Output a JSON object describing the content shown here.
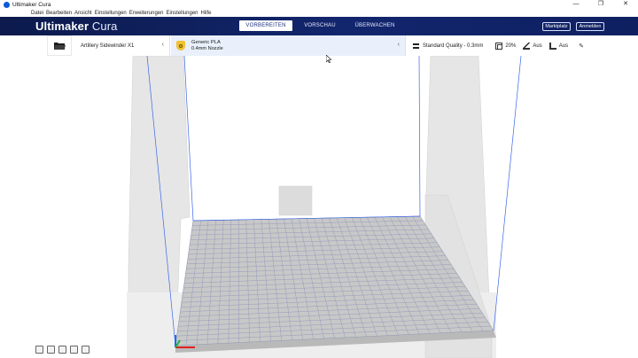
{
  "window": {
    "title": "Ultimaker Cura",
    "controls": [
      "—",
      "❐",
      "✕"
    ]
  },
  "menu": [
    "Datei",
    "Bearbeiten",
    "Ansicht",
    "Einstellungen",
    "Erweiterungen",
    "Einstellungen",
    "Hilfe"
  ],
  "header": {
    "logo_bold": "Ultimaker",
    "logo_light": "Cura",
    "stages": [
      {
        "label": "VORBEREITEN",
        "active": true
      },
      {
        "label": "VORSCHAU",
        "active": false
      },
      {
        "label": "ÜBERWACHEN",
        "active": false
      }
    ],
    "marketplace": "Marktplatz",
    "signin": "Anmelden"
  },
  "toolbar": {
    "printer": "Artillery Sidewinder X1",
    "material_name": "Generic PLA",
    "nozzle": "0.4mm Nozzle",
    "quality": "Standard Quality - 0.3mm",
    "infill": "20%",
    "support": "Aus",
    "adhesion": "Aus"
  },
  "colors": {
    "header_bg": "#0d1d53",
    "accent": "#1b2f78",
    "material_bg": "#e9f0fb",
    "material_badge": "#f1c232",
    "build_volume_line": "#3b67e8",
    "grid_line": "#8d97ba"
  },
  "icons": [
    "cura-logo-icon",
    "folder-open-icon",
    "chevron-left-icon",
    "material-icon",
    "quality-icon",
    "infill-icon",
    "support-icon",
    "adhesion-icon",
    "pencil-icon",
    "view-3d-icon",
    "view-front-icon",
    "view-top-icon",
    "view-left-icon",
    "view-right-icon",
    "cursor-icon"
  ]
}
